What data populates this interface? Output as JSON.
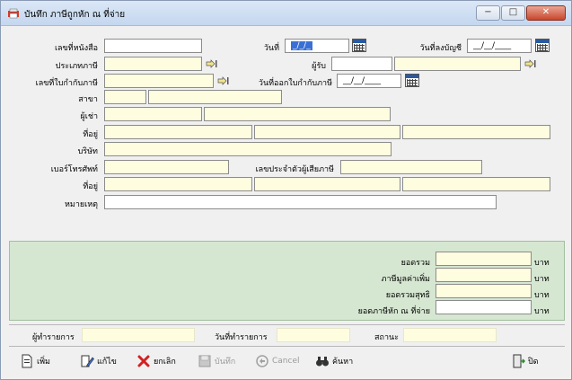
{
  "window": {
    "title": "บันทึก ภาษีถูกหัก ณ ที่จ่าย",
    "buttons": {
      "minimize": "−",
      "maximize": "□",
      "close": "✕"
    }
  },
  "form": {
    "doc_no_label": "เลขที่หนังสือ",
    "doc_no_value": "",
    "date_label": "วันที่",
    "date_value": "_/_/_",
    "post_date_label": "วันที่ลงบัญชี",
    "post_date_value": "__/__/____",
    "tax_type_label": "ประเภทภาษี",
    "tax_type_value": "",
    "receiver_label": "ผู้รับ",
    "receiver_code": "",
    "receiver_name": "",
    "tax_invoice_no_label": "เลขที่ใบกำกับภาษี",
    "tax_invoice_no_value": "",
    "tax_invoice_date_label": "วันที่ออกใบกำกับภาษี",
    "tax_invoice_date_value": "__/__/____",
    "branch_label": "สาขา",
    "tenant_label": "ผู้เช่า",
    "address_label": "ที่อยู่",
    "company_label": "บริษัท",
    "phone_label": "เบอร์โทรศัพท์",
    "taxpayer_id_label": "เลขประจำตัวผู้เสียภาษี",
    "address2_label": "ที่อยู่",
    "remark_label": "หมายเหตุ"
  },
  "totals": {
    "total_label": "ยอดรวม",
    "vat_label": "ภาษีมูลค่าเพิ่ม",
    "net_label": "ยอดรวมสุทธิ",
    "withholding_label": "ยอดภาษีหัก ณ ที่จ่าย",
    "currency": "บาท"
  },
  "status_bar": {
    "operator_label": "ผู้ทำรายการ",
    "txn_date_label": "วันที่ทำรายการ",
    "status_label": "สถานะ"
  },
  "toolbar": {
    "add": "เพิ่ม",
    "edit": "แก้ไข",
    "cancel_doc": "ยกเลิก",
    "save": "บันทึก",
    "cancel": "Cancel",
    "search": "ค้นหา",
    "close": "ปิด"
  },
  "colors": {
    "field_bg": "#fffde0",
    "totals_panel": "#d5e6d1",
    "selection": "#3a70d6"
  }
}
